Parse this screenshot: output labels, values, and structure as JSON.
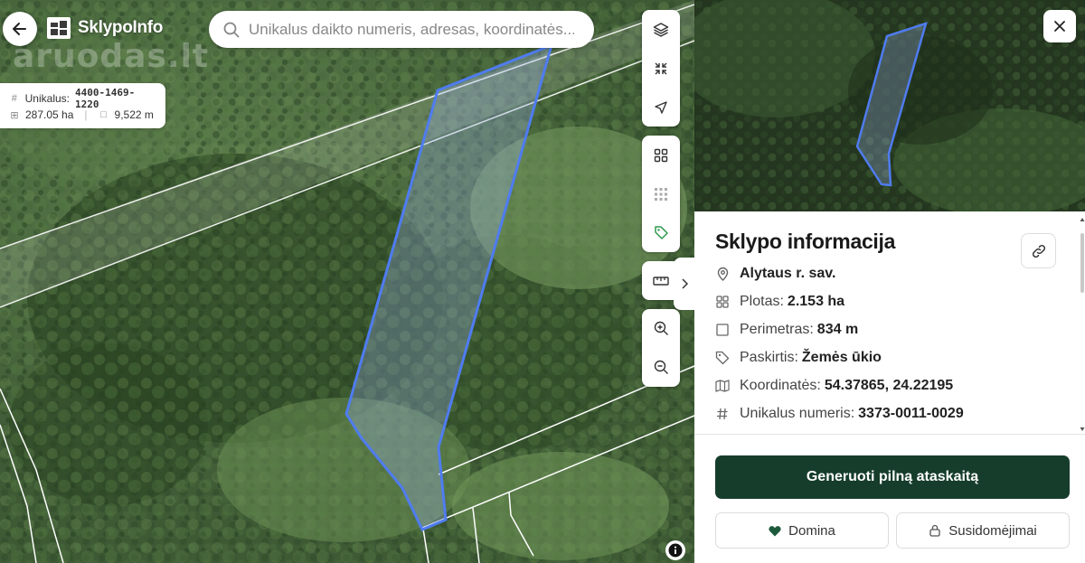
{
  "app": {
    "brand": "SklypoInfo",
    "watermark": "aruodas.lt"
  },
  "search": {
    "placeholder": "Unikalus daikto numeris, adresas, koordinatės..."
  },
  "map_card": {
    "unique_label": "Unikalus:",
    "unique_value": "4400-1469-1220",
    "area": "287.05 ha",
    "perimeter": "9,522 m"
  },
  "map_tools": {
    "layers": "layers-icon",
    "collapse": "collapse-icon",
    "locate": "navigation-arrow-icon",
    "grid": "grid-icon",
    "pattern": "dot-grid-icon",
    "tag": "tag-icon",
    "ruler": "ruler-icon",
    "zoom_in": "zoom-in-icon",
    "zoom_out": "zoom-out-icon"
  },
  "panel": {
    "title": "Sklypo informacija",
    "location": "Alytaus r. sav.",
    "area_label": "Plotas:",
    "area_value": "2.153 ha",
    "perimeter_label": "Perimetras:",
    "perimeter_value": "834 m",
    "purpose_label": "Paskirtis:",
    "purpose_value": "Žemės ūkio",
    "coords_label": "Koordinatės:",
    "coords_value": "54.37865, 24.22195",
    "unique_label": "Unikalus numeris:",
    "unique_value": "3373-0011-0029",
    "primary_button": "Generuoti pilną ataskaitą",
    "like_button": "Domina",
    "interest_button": "Susidomėjimai"
  },
  "colors": {
    "primary": "#163d2c",
    "parcel_outline": "#4f7cf0",
    "heart": "#1d5a3c"
  }
}
